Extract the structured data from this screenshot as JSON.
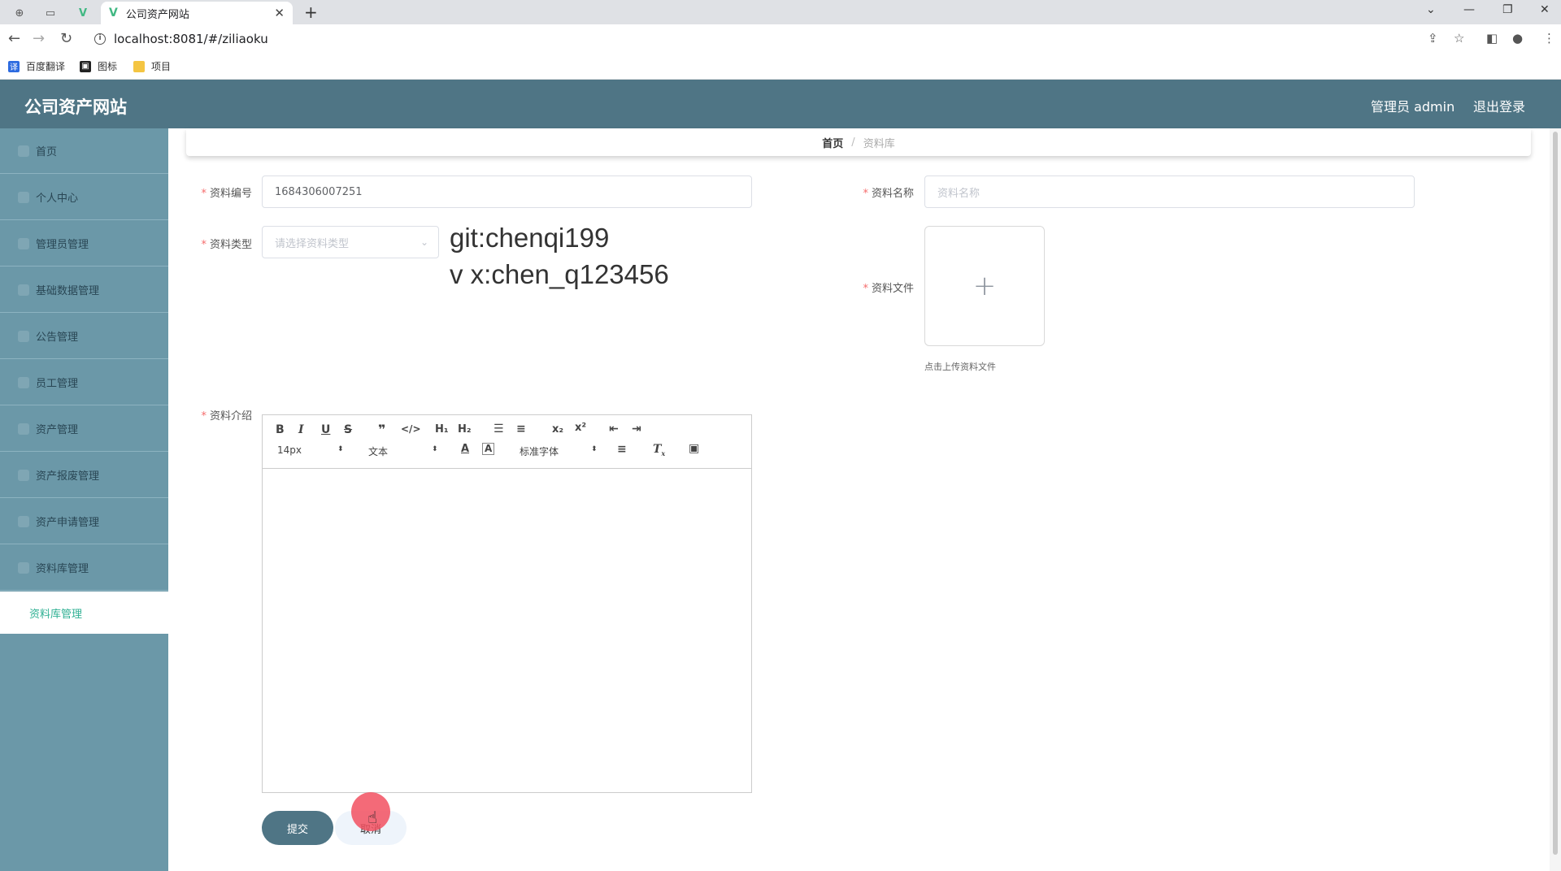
{
  "browser": {
    "tab_title": "公司资产网站",
    "url": "localhost:8081/#/ziliaoku",
    "bookmarks": [
      "百度翻译",
      "图标",
      "项目"
    ]
  },
  "header": {
    "title": "公司资产网站",
    "admin": "管理员 admin",
    "logout": "退出登录"
  },
  "sidebar": {
    "items": [
      "首页",
      "个人中心",
      "管理员管理",
      "基础数据管理",
      "公告管理",
      "员工管理",
      "资产管理",
      "资产报废管理",
      "资产申请管理",
      "资料库管理"
    ],
    "sub_active": "资料库管理"
  },
  "breadcrumb": {
    "home": "首页",
    "sep": "/",
    "current": "资料库"
  },
  "form": {
    "code_label": "资料编号",
    "code_value": "1684306007251",
    "name_label": "资料名称",
    "name_placeholder": "资料名称",
    "type_label": "资料类型",
    "type_placeholder": "请选择资料类型",
    "file_label": "资料文件",
    "upload_tip": "点击上传资料文件",
    "intro_label": "资料介绍",
    "submit": "提交",
    "cancel": "取消"
  },
  "overlay": {
    "line1": "git:chenqi199",
    "line2": "v x:chen_q123456"
  },
  "editor": {
    "font_size": "14px",
    "header_select": "文本",
    "font_family": "标准字体"
  },
  "colors": {
    "header": "#4f7585",
    "sidebar": "#6b98a8",
    "active": "#2fb093",
    "required": "#f56c6c"
  }
}
